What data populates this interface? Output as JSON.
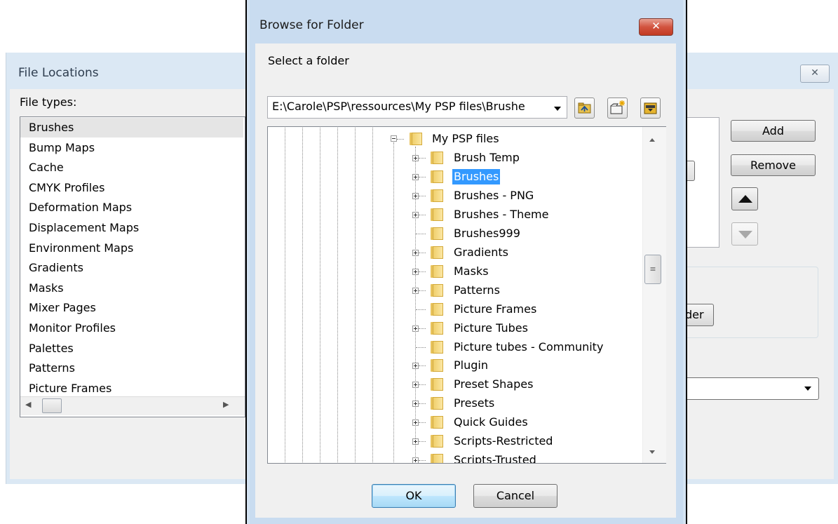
{
  "background_window": {
    "title": "File Locations",
    "close_glyph": "✕",
    "file_types_label": "File types:",
    "file_types": [
      "Brushes",
      "Bump Maps",
      "Cache",
      "CMYK Profiles",
      "Deformation Maps",
      "Displacement Maps",
      "Environment Maps",
      "Gradients",
      "Masks",
      "Mixer Pages",
      "Monitor Profiles",
      "Palettes",
      "Patterns",
      "Picture Frames"
    ],
    "selected_file_type": "Brushes",
    "add_label": "Add",
    "remove_label": "Remove",
    "partial_folder_button_text": "der",
    "scroll_left_glyph": "◀",
    "scroll_right_glyph": "▶"
  },
  "dialog": {
    "title": "Browse for Folder",
    "close_glyph": "✕",
    "instruction": "Select a folder",
    "path": "E:\\Carole\\PSP\\ressources\\My PSP files\\Brushe",
    "toolbar_icons": [
      "up-folder-icon",
      "new-folder-icon",
      "open-folder-icon"
    ],
    "tree": {
      "parent": "My PSP files",
      "items": [
        {
          "label": "Brush Temp",
          "expandable": true
        },
        {
          "label": "Brushes",
          "expandable": true,
          "selected": true
        },
        {
          "label": "Brushes - PNG",
          "expandable": true
        },
        {
          "label": "Brushes - Theme",
          "expandable": true
        },
        {
          "label": "Brushes999",
          "expandable": false
        },
        {
          "label": "Gradients",
          "expandable": true
        },
        {
          "label": "Masks",
          "expandable": true
        },
        {
          "label": "Patterns",
          "expandable": true
        },
        {
          "label": "Picture Frames",
          "expandable": false
        },
        {
          "label": "Picture Tubes",
          "expandable": true
        },
        {
          "label": "Picture tubes - Community",
          "expandable": false
        },
        {
          "label": "Plugin",
          "expandable": true
        },
        {
          "label": "Preset Shapes",
          "expandable": true
        },
        {
          "label": "Presets",
          "expandable": true
        },
        {
          "label": "Quick Guides",
          "expandable": true
        },
        {
          "label": "Scripts-Restricted",
          "expandable": true
        },
        {
          "label": "Scripts-Trusted",
          "expandable": true
        }
      ]
    },
    "ok_label": "OK",
    "cancel_label": "Cancel",
    "accent_color": "#3399ff"
  }
}
